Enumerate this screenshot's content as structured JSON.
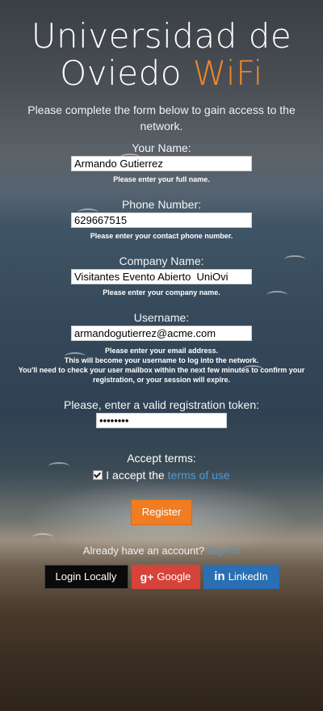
{
  "header": {
    "title_line1": "Universidad de",
    "title_main": "Oviedo ",
    "title_accent": "WiFi"
  },
  "intro": "Please complete the form below to gain access to the network.",
  "colors": {
    "accent": "#f07d22",
    "link": "#4d9ad6",
    "google": "#d6433a",
    "linkedin": "#2a6fb3"
  },
  "fields": [
    {
      "label": "Your Name:",
      "value": "Armando Gutierrez",
      "hint": "Please enter your full name."
    },
    {
      "label": "Phone Number:",
      "value": "629667515",
      "hint": "Please enter your contact phone number."
    },
    {
      "label": "Company Name:",
      "value": "Visitantes Evento Abierto  UniOvi",
      "hint": "Please enter your company name."
    },
    {
      "label": "Username:",
      "value": "armandogutierrez@acme.com",
      "hint_lines": [
        "Please enter your email address.",
        "This will become your username to log into the network.",
        "You'll need to check your user mailbox within the next few minutes to confirm your registration, or your session will expire."
      ]
    }
  ],
  "token": {
    "label": "Please, enter a valid registration token:",
    "value": "12345678"
  },
  "terms": {
    "heading": "Accept terms:",
    "text": "I accept the ",
    "link": "terms of use",
    "checked": true
  },
  "register_label": "Register",
  "signin": {
    "text": "Already have an account? ",
    "link": "Sign In"
  },
  "social": {
    "local": "Login Locally",
    "google_icon": "g+",
    "google": "Google",
    "linkedin_icon": "in",
    "linkedin": "LinkedIn"
  }
}
